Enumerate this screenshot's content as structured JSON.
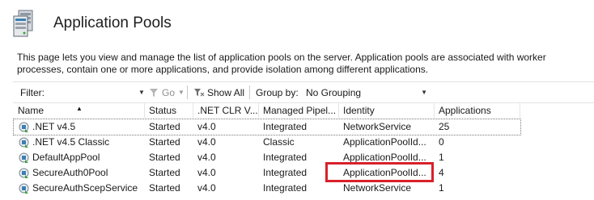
{
  "header": {
    "title": "Application Pools",
    "icon": "server-pool-icon",
    "description": "This page lets you view and manage the list of application pools on the server. Application pools are associated with worker processes, contain one or more applications, and provide isolation among different applications."
  },
  "toolbar": {
    "filter_label": "Filter:",
    "filter_value": "",
    "go_label": "Go",
    "show_all_label": "Show All",
    "group_by_label": "Group by:",
    "group_by_value": "No Grouping"
  },
  "grid": {
    "columns": [
      "Name",
      "Status",
      ".NET CLR V...",
      "Managed Pipel...",
      "Identity",
      "Applications"
    ],
    "sort_column": "Name",
    "rows": [
      {
        "name": ".NET v4.5",
        "status": "Started",
        "clr": "v4.0",
        "pipeline": "Integrated",
        "identity": "NetworkService",
        "apps": "25"
      },
      {
        "name": ".NET v4.5 Classic",
        "status": "Started",
        "clr": "v4.0",
        "pipeline": "Classic",
        "identity": "ApplicationPoolId...",
        "apps": "0"
      },
      {
        "name": "DefaultAppPool",
        "status": "Started",
        "clr": "v4.0",
        "pipeline": "Integrated",
        "identity": "ApplicationPoolId...",
        "apps": "1"
      },
      {
        "name": "SecureAuth0Pool",
        "status": "Started",
        "clr": "v4.0",
        "pipeline": "Integrated",
        "identity": "ApplicationPoolId...",
        "apps": "4"
      },
      {
        "name": "SecureAuthScepService",
        "status": "Started",
        "clr": "v4.0",
        "pipeline": "Integrated",
        "identity": "NetworkService",
        "apps": "1"
      }
    ]
  },
  "colors": {
    "highlight": "#d9202a",
    "accent": "#3c7fb1"
  }
}
